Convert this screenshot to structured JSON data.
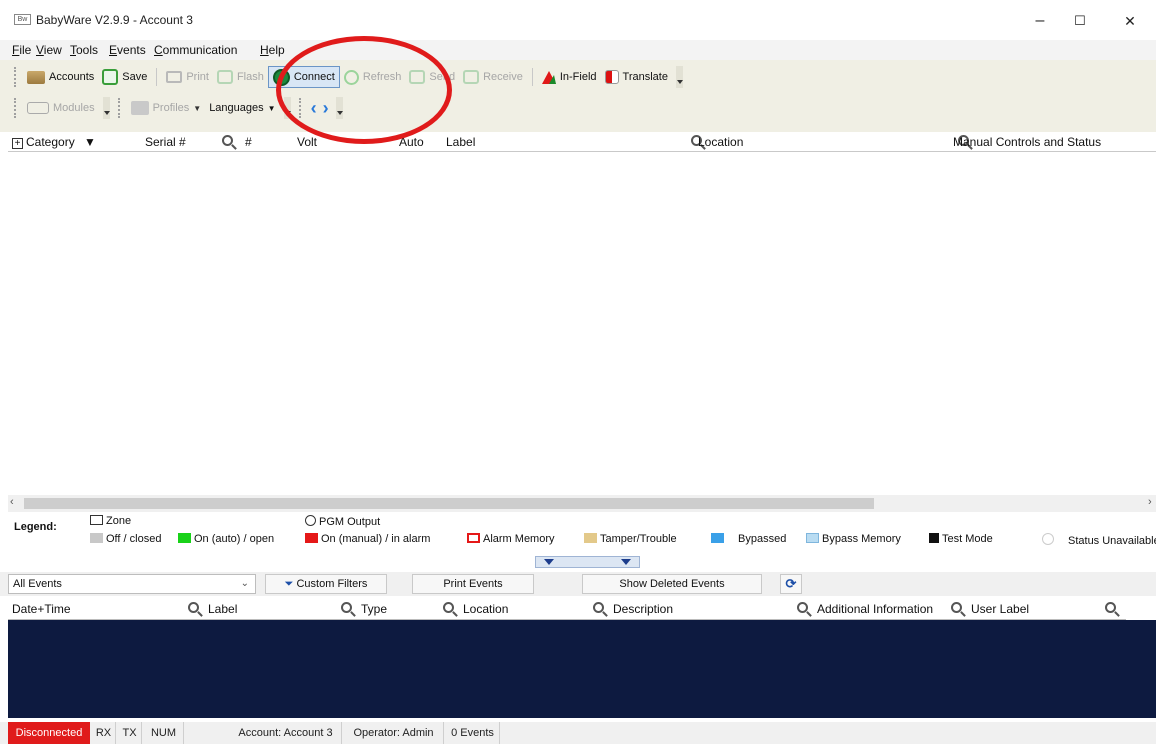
{
  "window": {
    "title": "BabyWare V2.9.9 - Account 3",
    "icon_text": "Bw",
    "minimize": "–",
    "maximize": "☐",
    "close": "✕"
  },
  "menu": [
    "File",
    "View",
    "Tools",
    "Events",
    "Communication",
    "Help"
  ],
  "toolbar1": {
    "accounts": "Accounts",
    "save": "Save",
    "print": "Print",
    "flash": "Flash",
    "connect": "Connect",
    "refresh": "Refresh",
    "send": "Send",
    "receive": "Receive",
    "in_field": "In-Field",
    "translate": "Translate"
  },
  "toolbar2": {
    "modules": "Modules",
    "profiles": "Profiles",
    "languages": "Languages",
    "back": "‹",
    "forward": "›"
  },
  "grid_columns": {
    "category": "Category",
    "category_arrow": "▼",
    "serial": "Serial #",
    "number": "#",
    "volt": "Volt",
    "auto": "Auto",
    "label": "Label",
    "location": "Location",
    "manual": "Manual Controls and Status"
  },
  "legend": {
    "title": "Legend:",
    "zone": "Zone",
    "pgm": "PGM Output",
    "items": [
      {
        "label": "Off / closed",
        "color": "#c8c8c8"
      },
      {
        "label": "On (auto) / open",
        "color": "#19d219"
      },
      {
        "label": "On (manual) / in alarm",
        "color": "#e51818"
      },
      {
        "label": "Alarm Memory",
        "color": "#ffffff"
      },
      {
        "label": "Tamper/Trouble",
        "color": "#e3c98a"
      },
      {
        "label": "Bypassed",
        "color": "#3aa0e8"
      },
      {
        "label": "Bypass Memory",
        "color": "#b9dcf2"
      },
      {
        "label": "Test Mode",
        "color": "#111111"
      },
      {
        "label": "Status Unavailable",
        "color": "#ffffff"
      }
    ]
  },
  "events": {
    "filter_value": "All Events",
    "custom_filters": "Custom Filters",
    "print_events": "Print Events",
    "show_deleted": "Show Deleted Events",
    "columns": {
      "datetime": "Date+Time",
      "label": "Label",
      "type": "Type",
      "location": "Location",
      "description": "Description",
      "additional": "Additional Information",
      "user_label": "User Label"
    }
  },
  "status": {
    "connection": "Disconnected",
    "rx": "RX",
    "tx": "TX",
    "num": "NUM",
    "account": "Account: Account 3",
    "operator": "Operator: Admin",
    "events_count": "0 Events"
  },
  "colors": {
    "accent_blue": "#2979d9",
    "annotation": "#e01b1b",
    "events_bg": "#0d1a40"
  }
}
